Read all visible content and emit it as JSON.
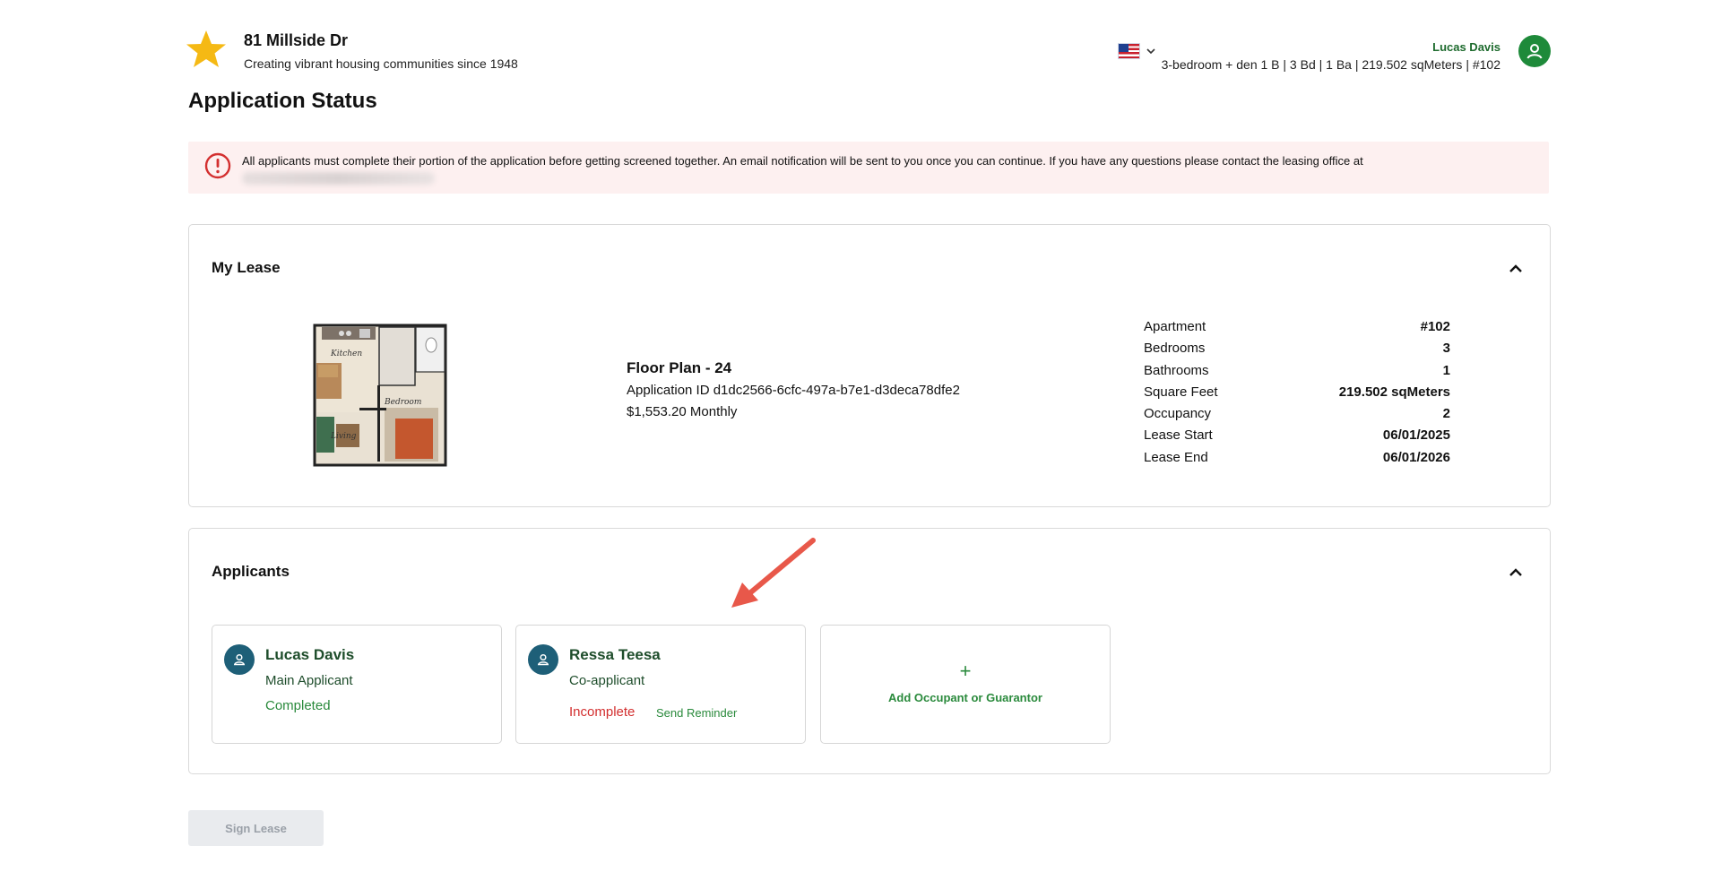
{
  "header": {
    "property_name": "81 Millside Dr",
    "tagline": "Creating vibrant housing communities since 1948",
    "language_flag": "us-flag-icon",
    "user_name": "Lucas Davis",
    "unit_summary": "3-bedroom + den 1 B | 3 Bd | 1 Ba | 219.502 sqMeters | #102"
  },
  "page_title": "Application Status",
  "alert": {
    "message": "All applicants must complete their portion of the application before getting screened together. An email notification will be sent to you once you can continue. If you have any questions please contact the leasing office at"
  },
  "lease": {
    "title": "My Lease",
    "floor_plan_name": "Floor Plan - 24",
    "application_id": "Application ID d1dc2566-6cfc-497a-b7e1-d3deca78dfe2",
    "price": "$1,553.20 Monthly",
    "floorplan_labels": {
      "kitchen": "Kitchen",
      "bedroom": "Bedroom",
      "living": "Living"
    },
    "details": [
      {
        "label": "Apartment",
        "value": "#102"
      },
      {
        "label": "Bedrooms",
        "value": "3"
      },
      {
        "label": "Bathrooms",
        "value": "1"
      },
      {
        "label": "Square Feet",
        "value": "219.502 sqMeters"
      },
      {
        "label": "Occupancy",
        "value": "2"
      },
      {
        "label": "Lease Start",
        "value": "06/01/2025"
      },
      {
        "label": "Lease End",
        "value": "06/01/2026"
      }
    ]
  },
  "applicants": {
    "title": "Applicants",
    "list": [
      {
        "name": "Lucas Davis",
        "role": "Main Applicant",
        "status": "Completed"
      },
      {
        "name": "Ressa Teesa",
        "role": "Co-applicant",
        "status": "Incomplete",
        "action": "Send Reminder"
      }
    ],
    "add_plus": "+",
    "add_label": "Add Occupant or Guarantor"
  },
  "sign_lease_label": "Sign Lease",
  "colors": {
    "brand_green": "#1e6b2e",
    "status_ok": "#2a8a3c",
    "status_bad": "#d32f2f",
    "alert_bg": "#fdf0f0",
    "avatar_teal": "#1e5f78",
    "annotation_arrow": "#e8584a"
  }
}
